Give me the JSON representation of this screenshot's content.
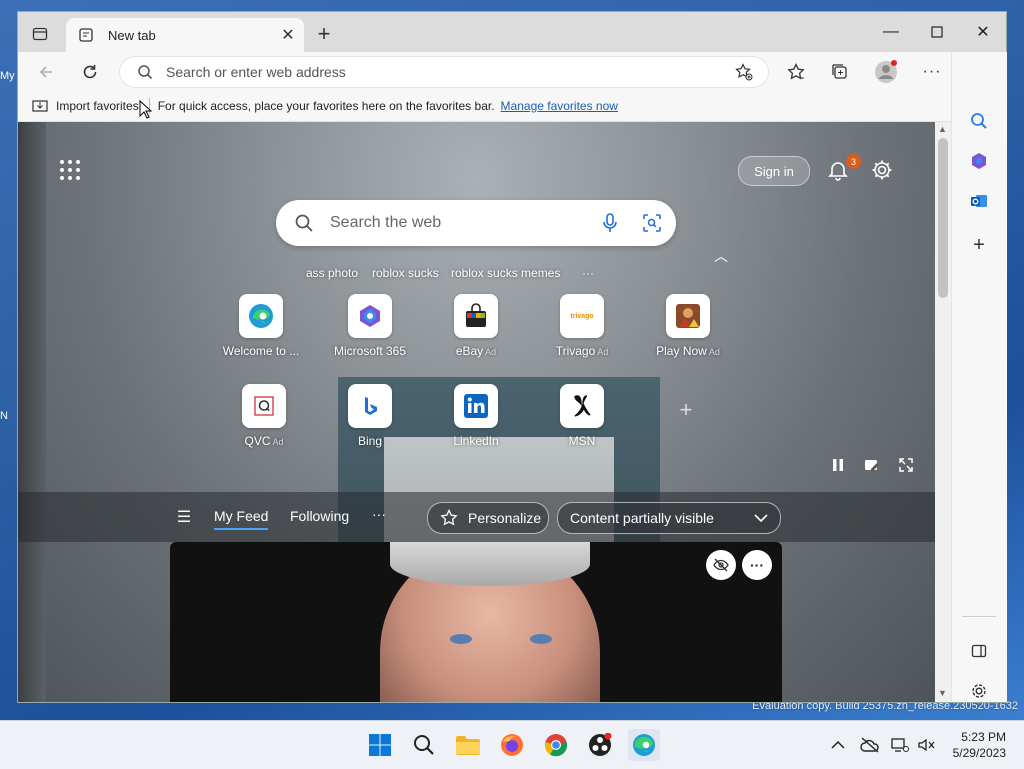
{
  "browser": {
    "tab_title": "New tab",
    "address_placeholder": "Search or enter web address"
  },
  "favorites_bar": {
    "import_label": "Import favorites",
    "message": "For quick access, place your favorites here on the favorites bar.",
    "manage_link": "Manage favorites now"
  },
  "newtab": {
    "sign_in": "Sign in",
    "notification_count": "3",
    "search_placeholder": "Search the web",
    "trending": [
      "ass photo",
      "roblox sucks",
      "roblox sucks memes"
    ],
    "trending_more": "···",
    "quick_links_row1": [
      {
        "label": "Welcome to ...",
        "ad": "",
        "icon": "edge-icon"
      },
      {
        "label": "Microsoft 365",
        "ad": "",
        "icon": "m365-icon"
      },
      {
        "label": "eBay",
        "ad": "Ad",
        "icon": "ebay-icon"
      },
      {
        "label": "Trivago",
        "ad": "Ad",
        "icon": "trivago-icon"
      },
      {
        "label": "Play Now",
        "ad": "Ad",
        "icon": "game-icon"
      }
    ],
    "quick_links_row2": [
      {
        "label": "QVC",
        "ad": "Ad",
        "icon": "qvc-icon"
      },
      {
        "label": "Bing",
        "ad": "",
        "icon": "bing-icon"
      },
      {
        "label": "LinkedIn",
        "ad": "",
        "icon": "linkedin-icon"
      },
      {
        "label": "MSN",
        "ad": "",
        "icon": "msn-icon"
      }
    ],
    "trivago_logo_text": "trivago",
    "feed_tabs": [
      "My Feed",
      "Following"
    ],
    "feed_more": "···",
    "personalize": "Personalize",
    "content_visibility": "Content partially visible"
  },
  "taskbar": {
    "time": "5:23 PM",
    "date": "5/29/2023"
  },
  "watermark": "Evaluation copy. Build 25375.zn_release.230520-1632",
  "colors": {
    "accent": "#1a5fb4",
    "badge": "#e05a1c",
    "linkedin": "#0a66c2",
    "edge": "#1f9bd6"
  }
}
